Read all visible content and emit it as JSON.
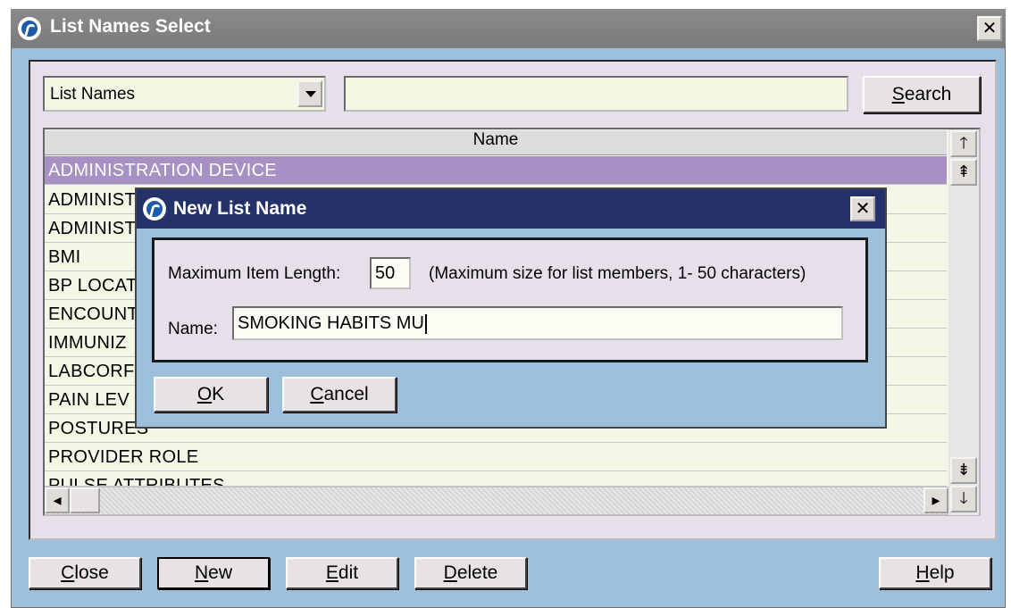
{
  "window": {
    "title": "List Names Select",
    "close_glyph": "✕"
  },
  "filter": {
    "field_value": "List Names",
    "search_value": "",
    "search_button": "Search",
    "search_mnemonic": "S",
    "search_rest": "earch"
  },
  "table": {
    "header": "Name",
    "rows": [
      "ADMINISTRATION DEVICE",
      "ADMINIST",
      "ADMINIST",
      "BMI",
      "BP LOCAT",
      "ENCOUNT",
      "IMMUNIZ",
      "LABCORF",
      "PAIN LEV",
      "POSTURES",
      "PROVIDER ROLE",
      "PULSE ATTRIBUTES"
    ],
    "selected_index": 0
  },
  "footer": {
    "close": {
      "m": "C",
      "r": "lose"
    },
    "new": {
      "m": "N",
      "r": "ew"
    },
    "edit": {
      "m": "E",
      "r": "dit"
    },
    "delete": {
      "m": "D",
      "r": "elete"
    },
    "help": {
      "m": "H",
      "r": "elp"
    }
  },
  "dialog": {
    "title": "New List Name",
    "max_label": "Maximum Item Length:",
    "max_value": "50",
    "max_hint": "(Maximum size for list members, 1- 50 characters)",
    "name_label": "Name:",
    "name_value": "SMOKING HABITS MU",
    "ok": {
      "m": "O",
      "r": "K"
    },
    "cancel": {
      "m": "C",
      "r": "ancel"
    }
  },
  "icons": [
    "app-logo-icon",
    "close-icon",
    "dropdown-arrow-icon",
    "scroll-up-icon",
    "page-up-icon",
    "page-down-icon",
    "scroll-down-icon",
    "scroll-left-icon",
    "scroll-right-icon"
  ]
}
